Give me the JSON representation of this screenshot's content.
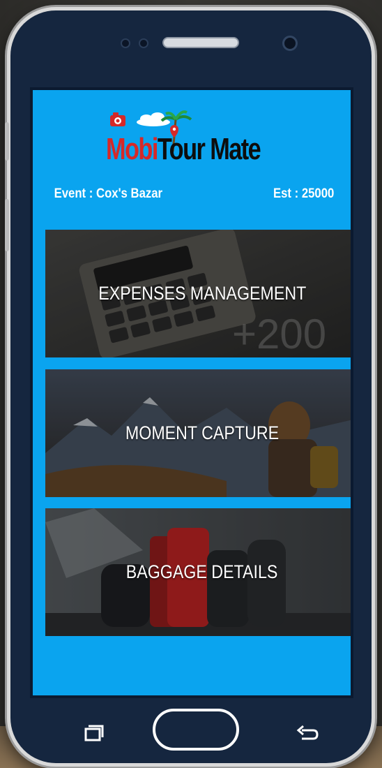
{
  "app": {
    "logo": {
      "part1": "Mobi",
      "part2": "Tour Mate"
    }
  },
  "meta": {
    "event": "Event : Cox's Bazar",
    "estimate": "Est : 25000"
  },
  "menu": [
    {
      "label": "EXPENSES MANAGEMENT",
      "image": "calculator-photo"
    },
    {
      "label": "MOMENT CAPTURE",
      "image": "mountain-photographer-photo"
    },
    {
      "label": "BAGGAGE DETAILS",
      "image": "luggage-photo"
    }
  ],
  "decor": {
    "calculator_overlay_text": "+200"
  },
  "nav": {
    "recent": "recent-apps-icon",
    "home": "home-button",
    "back": "back-icon"
  },
  "colors": {
    "screen_bg": "#0aa4ef",
    "logo_red": "#d62828",
    "logo_dark": "#0d0d0d",
    "frame": "#15263f"
  }
}
